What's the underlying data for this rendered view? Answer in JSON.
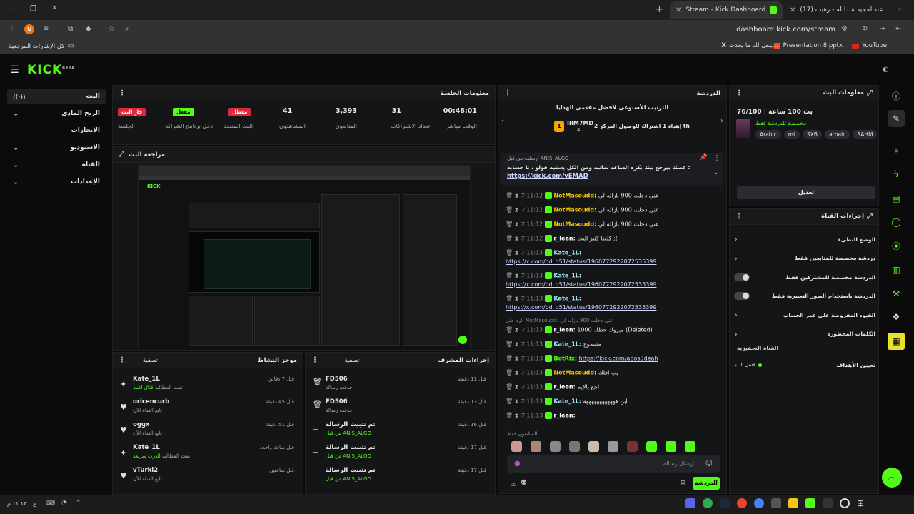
{
  "browser": {
    "tabs": [
      {
        "label": "Stream - Kick Dashboard",
        "active": true
      },
      {
        "label": "(17) عبدالمجيد عبدالله - رهيب",
        "active": false
      }
    ],
    "url": "dashboard.kick.com/stream",
    "bookmarks": [
      "YouTube",
      "Presentation 8.pptx",
      "ينقل لك ما يحدث...",
      "كل الإشارات المرجعية"
    ]
  },
  "app": {
    "logo": "KICK",
    "logo_sup": "BETA",
    "sidebar": [
      {
        "label": "البث",
        "active": true
      },
      {
        "label": "الربح المادي"
      },
      {
        "label": "الإنجازات"
      },
      {
        "label": "الاستوديو"
      },
      {
        "label": "القناة"
      },
      {
        "label": "الإعدادات"
      }
    ],
    "session": {
      "title": "معلومات الجلسة",
      "stats": [
        {
          "value": "00:48:01",
          "label": "الوقت مباشر"
        },
        {
          "value": "31",
          "label": "تعداد الاشتراكات"
        },
        {
          "value": "3,393",
          "label": "المتابعون"
        },
        {
          "value": "41",
          "label": "المشاهدون"
        }
      ],
      "badges": [
        {
          "text": "معطل",
          "label": "البث المتعدد"
        },
        {
          "text": "مفعل",
          "label": "دخل برنامج الشراكة"
        },
        {
          "text": "جارٍ البث",
          "label": "الجلسة"
        }
      ]
    },
    "preview_title": "مراجعة البث",
    "activity": {
      "title": "موجز النشاط",
      "filter": "تصفية",
      "items": [
        {
          "name": "Kate_1L",
          "action": "تمت المطالبة",
          "detail": "قتال اغنية",
          "time": "قبل 7 دقائق"
        },
        {
          "name": "oricencurb",
          "action": "تابع القناة الآن",
          "detail": "",
          "time": "قبل 45 دقيقة"
        },
        {
          "name": "oggx",
          "action": "تابع القناة الآن",
          "detail": "",
          "time": "قبل 51 دقيقة"
        },
        {
          "name": "Kate_1L",
          "action": "تمت المطالبة",
          "detail": "الدرب سريعه",
          "time": "قبل ساعة واحدة"
        },
        {
          "name": "vTurki2",
          "action": "تابع القناة الآن",
          "detail": "",
          "time": "قبل ساعتين"
        }
      ]
    },
    "mod": {
      "title": "إجراءات المشرف",
      "filter": "تصفية",
      "items": [
        {
          "name": "FD506",
          "action": "حذفت رسالة",
          "time": "قبل 11 دقيقة"
        },
        {
          "name": "FD506",
          "action": "حذفت رسالة",
          "time": "قبل 13 دقيقة"
        },
        {
          "name": "تم تثبيت الرسالة",
          "action": "من قبل ANIS_ALGO",
          "time": "قبل 16 دقيقة"
        },
        {
          "name": "تم تثبيت الرسالة",
          "action": "من قبل ANIS_ALGO",
          "time": "قبل 17 دقيقة"
        },
        {
          "name": "تم تثبيت الرسالة",
          "action": "من قبل ANIS_ALGO",
          "time": "قبل 17 دقيقة"
        }
      ]
    },
    "chat": {
      "title": "الدردشة",
      "leaderboard_title": "الترتيب الأسبوعي لأفضل مقدمي الهدايا",
      "leader_name": "IIIM7MD",
      "leader_count": "4",
      "leader_rank": "1",
      "leader_msg": "إهداء 1 اشتراك للوصول المركز 2 th",
      "pinned_by": "أرسلت من قبل ANIS_ALGO",
      "pinned_text": "عصك بيرجع بيك بكره الساعه ثمانيه ومن الكل يعطيه فولو ، نا حسابه :",
      "pinned_link": "https://kick.com/vEMAD",
      "messages": [
        {
          "time": "11:12",
          "user": "NotMasoudd",
          "text": "عني دخلت 900 بازاله لي"
        },
        {
          "time": "11:12",
          "user": "NotMasoudd",
          "text": "عني دخلت 900 بازاله لي"
        },
        {
          "time": "11:12",
          "user": "NotMasoudd",
          "text": "عني دخلت 900 بازاله لي"
        },
        {
          "time": "11:12",
          "user": "r_leen",
          "text": "كذبنا كثير البث ;("
        },
        {
          "time": "11:13",
          "user": "Kate_1L",
          "text": "https://x.com/od_o51/status/1960772922072535399"
        },
        {
          "time": "11:13",
          "user": "Kate_1L",
          "text": "https://x.com/od_o51/status/1960772922072535399"
        },
        {
          "time": "11:13",
          "user": "Kate_1L",
          "text": "https://x.com/od_o51/status/1960772922072535399"
        },
        {
          "time": "11:13",
          "user": "r_leen",
          "text": "مبروك حظك 1000 (Deleted)"
        },
        {
          "time": "11:13",
          "user": "Kate_1L",
          "text": "مسموح"
        },
        {
          "time": "11:13",
          "user": "BotRix",
          "text": "https://kick.com/abos3deah"
        },
        {
          "time": "11:13",
          "user": "NotMasoudd",
          "text": "يب اقلك"
        },
        {
          "time": "11:13",
          "user": "r_leen",
          "text": "اخع بالايم"
        },
        {
          "time": "11:13",
          "user": "Kate_1L",
          "text": "ابن ههههههههههههه"
        },
        {
          "time": "11:13",
          "user": "r_leen",
          "text": ""
        }
      ],
      "reply_note": "الرد على NotMasoudd: عني دخلت 900 بازاله لي",
      "viewers_label": "المتابعون فقط",
      "input_placeholder": "إرسال رسالة",
      "send_label": "الدردشة"
    },
    "stream_info": {
      "title": "معلومات البث",
      "stream_name": "بث 100 ساعة | 76/100",
      "category": "مخصصة للدردشة فقط",
      "tags": [
        "Arabic",
        "mt",
        "SXB",
        "arbaic",
        "SAHM"
      ],
      "edit_label": "تعديل"
    },
    "channel_actions": {
      "title": "إجراءات القناة",
      "items": [
        {
          "label": "الوضع البطيء",
          "type": "chevron"
        },
        {
          "label": "دردشة مخصصة للمتابعين فقط",
          "type": "chevron"
        },
        {
          "label": "الدردشة مخصصة للمشتركين فقط",
          "type": "toggle"
        },
        {
          "label": "الدردشة باستخدام الصور التعبيرية فقط",
          "type": "toggle"
        },
        {
          "label": "القيود المفروضة على عمر الحساب",
          "type": "chevron"
        },
        {
          "label": "الكلمات المحظورة",
          "type": "chevron"
        }
      ],
      "section": "القناة التحفيزية",
      "goals_label": "تعيين الأهداف",
      "goals_value": "قسل 1"
    }
  },
  "taskbar": {
    "time": "١١:١٣ م",
    "lang": "ع"
  }
}
